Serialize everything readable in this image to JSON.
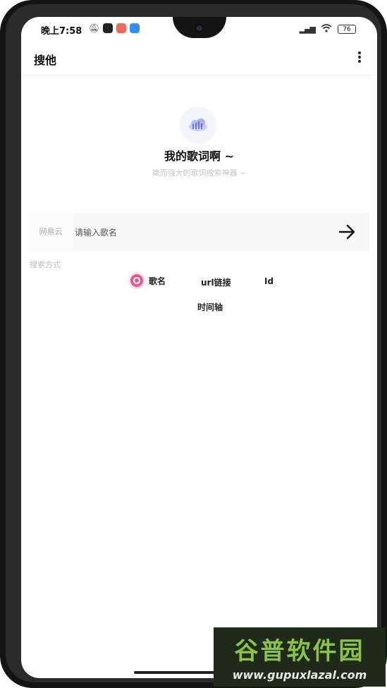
{
  "status_bar": {
    "time": "晚上7:58",
    "battery": "76"
  },
  "app_bar": {
    "title": "搜他"
  },
  "hero": {
    "title": "我的歌词啊 ~",
    "subtitle": "简而强大的歌词搜索神器 ~"
  },
  "search": {
    "source_label": "网易云",
    "placeholder": "请输入歌名"
  },
  "search_method": {
    "label": "搜索方式",
    "options": [
      {
        "label": "歌名",
        "selected": true
      },
      {
        "label": "url链接",
        "selected": false
      },
      {
        "label": "Id",
        "selected": false
      },
      {
        "label": "时间轴",
        "selected": false
      }
    ]
  },
  "colors": {
    "accent": "#e75a8f"
  },
  "watermark": {
    "title": "谷普软件园",
    "url": "www.gupuxlazal.com"
  }
}
